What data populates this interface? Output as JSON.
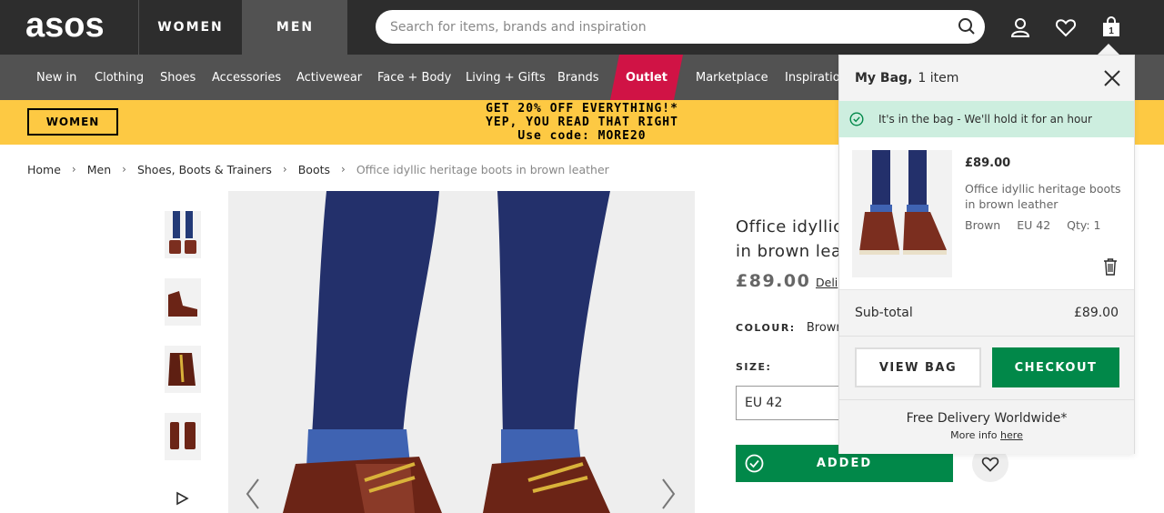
{
  "header": {
    "logo_text": "asos",
    "tabs": [
      {
        "label": "WOMEN"
      },
      {
        "label": "MEN"
      }
    ],
    "search": {
      "placeholder": "Search for items, brands and inspiration"
    },
    "bag_count": "1"
  },
  "nav": {
    "items": [
      {
        "label": "New in"
      },
      {
        "label": "Clothing"
      },
      {
        "label": "Shoes"
      },
      {
        "label": "Accessories"
      },
      {
        "label": "Activewear"
      },
      {
        "label": "Face + Body"
      },
      {
        "label": "Living + Gifts"
      },
      {
        "label": "Brands"
      },
      {
        "label": "Outlet"
      },
      {
        "label": "Marketplace"
      },
      {
        "label": "Inspiratio"
      }
    ],
    "outlet_color": "#d01345"
  },
  "promo": {
    "women_button": "WOMEN",
    "line1": "GET 20% OFF EVERYTHING!*",
    "line2": "YEP, YOU READ THAT RIGHT",
    "line3": "Use code: MORE20",
    "bg_color": "#fdc943"
  },
  "breadcrumb": {
    "items": [
      "Home",
      "Men",
      "Shoes, Boots & Trainers",
      "Boots"
    ],
    "current": "Office idyllic heritage boots in brown leather"
  },
  "product": {
    "title_line1": "Office idyllic",
    "title_line2": "in brown leat",
    "price": "£89.00",
    "delivery_link": "Deli",
    "colour_label": "COLOUR:",
    "colour_value": "Brown",
    "size_label": "SIZE:",
    "size_value": "EU 42",
    "added_label": "ADDED",
    "accent_color": "#018849"
  },
  "bag": {
    "title": "My Bag,",
    "count_text": "1 item",
    "message": "It's in the bag - We'll hold it for an hour",
    "item": {
      "price": "£89.00",
      "name": "Office idyllic heritage boots in brown leather",
      "colour": "Brown",
      "size": "EU 42",
      "qty": "Qty: 1"
    },
    "subtotal_label": "Sub-total",
    "subtotal_value": "£89.00",
    "view_bag": "VIEW BAG",
    "checkout": "CHECKOUT",
    "delivery_title": "Free Delivery Worldwide*",
    "more_info": "More info",
    "here_link": "here"
  }
}
